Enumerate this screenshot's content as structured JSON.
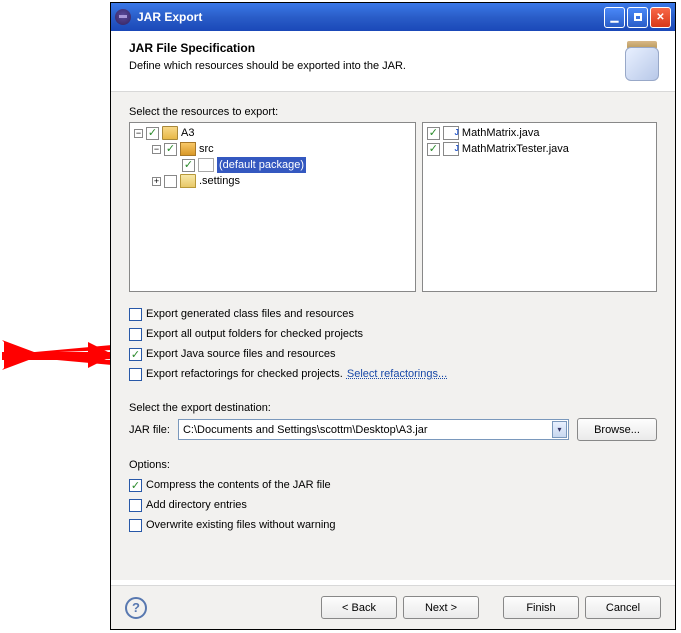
{
  "title": "JAR Export",
  "header": {
    "title": "JAR File Specification",
    "subtitle": "Define which resources should be exported into the JAR."
  },
  "labels": {
    "selectResources": "Select the resources to export:",
    "selectDest": "Select the export destination:",
    "jarFile": "JAR file:",
    "options": "Options:",
    "browse": "Browse...",
    "help": "?"
  },
  "tree": {
    "root": "A3",
    "src": "src",
    "defaultPackage": "(default package)",
    "settings": ".settings"
  },
  "glyphs": {
    "minus": "−",
    "plus": "+",
    "check": "✓",
    "close": "✕",
    "dd": "▾",
    "under": "▁"
  },
  "files": [
    {
      "name": "MathMatrix.java",
      "checked": true
    },
    {
      "name": "MathMatrixTester.java",
      "checked": true
    }
  ],
  "exportOptions": [
    {
      "label": "Export generated class files and resources",
      "checked": false
    },
    {
      "label": "Export all output folders for checked projects",
      "checked": false
    },
    {
      "label": "Export Java source files and resources",
      "checked": true
    },
    {
      "label": "Export refactorings for checked projects.",
      "checked": false,
      "link": "Select refactorings..."
    }
  ],
  "dest": {
    "value": "C:\\Documents and Settings\\scottm\\Desktop\\A3.jar"
  },
  "runOptions": [
    {
      "label": "Compress the contents of the JAR file",
      "checked": true
    },
    {
      "label": "Add directory entries",
      "checked": false
    },
    {
      "label": "Overwrite existing files without warning",
      "checked": false
    }
  ],
  "buttons": {
    "back": "< Back",
    "next": "Next >",
    "finish": "Finish",
    "cancel": "Cancel"
  }
}
